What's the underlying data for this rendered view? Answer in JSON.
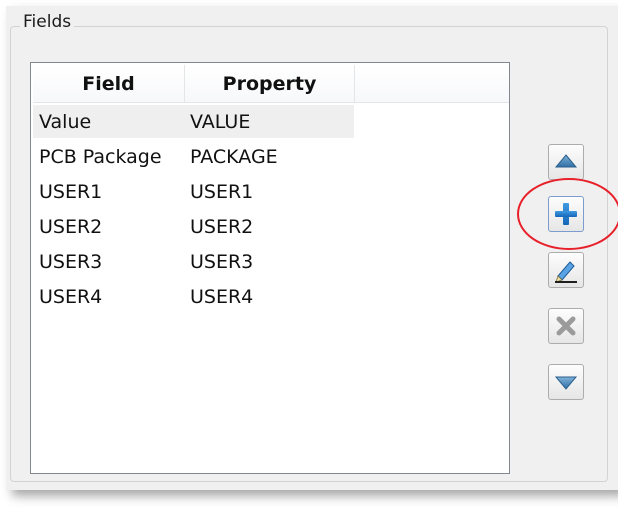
{
  "group": {
    "title": "Fields"
  },
  "table": {
    "columns": [
      "Field",
      "Property",
      ""
    ],
    "rows": [
      {
        "field": "Value",
        "property": "VALUE",
        "selected": true
      },
      {
        "field": "PCB Package",
        "property": "PACKAGE",
        "selected": false
      },
      {
        "field": "USER1",
        "property": "USER1",
        "selected": false
      },
      {
        "field": "USER2",
        "property": "USER2",
        "selected": false
      },
      {
        "field": "USER3",
        "property": "USER3",
        "selected": false
      },
      {
        "field": "USER4",
        "property": "USER4",
        "selected": false
      }
    ]
  },
  "buttons": {
    "move_up": {
      "icon": "up-triangle-icon"
    },
    "add": {
      "icon": "plus-icon"
    },
    "edit": {
      "icon": "pencil-icon"
    },
    "delete": {
      "icon": "x-icon",
      "enabled": false
    },
    "move_down": {
      "icon": "down-triangle-icon"
    }
  },
  "annotation": {
    "highlight_color": "#e8202a"
  }
}
